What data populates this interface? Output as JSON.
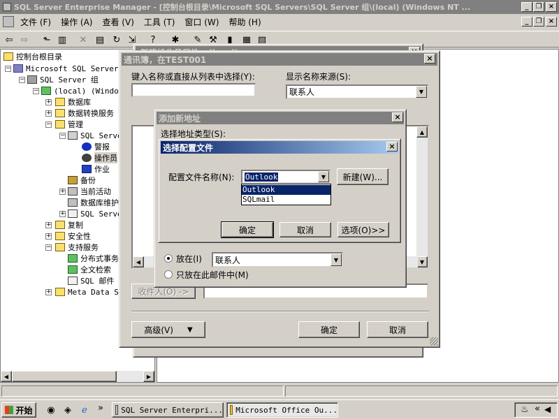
{
  "window": {
    "title": "SQL Server Enterprise Manager - [控制台根目录\\Microsoft SQL Servers\\SQL Server 组\\(local) (Windows NT ..."
  },
  "menu": [
    {
      "label": "文件 (F)"
    },
    {
      "label": "操作 (A)"
    },
    {
      "label": "查看 (V)"
    },
    {
      "label": "工具 (T)"
    },
    {
      "label": "窗口 (W)"
    },
    {
      "label": "帮助 (H)"
    }
  ],
  "tree": {
    "items": [
      {
        "label": "控制台根目录"
      },
      {
        "label": "Microsoft SQL Servers"
      },
      {
        "label": "SQL Server 组"
      },
      {
        "label": "(local) (Window"
      },
      {
        "label": "数据库"
      },
      {
        "label": "数据转换服务"
      },
      {
        "label": "管理"
      },
      {
        "label": "SQL Serve"
      },
      {
        "label": "警报"
      },
      {
        "label": "操作员"
      },
      {
        "label": "作业"
      },
      {
        "label": "备份"
      },
      {
        "label": "当前活动"
      },
      {
        "label": "数据库维护"
      },
      {
        "label": "SQL Serve"
      },
      {
        "label": "复制"
      },
      {
        "label": "安全性"
      },
      {
        "label": "支持服务"
      },
      {
        "label": "分布式事务"
      },
      {
        "label": "全文检索"
      },
      {
        "label": "SQL 邮件"
      },
      {
        "label": "Meta Data Se"
      }
    ]
  },
  "bg_dialog": {
    "title": "新建操作员属性 - (local)"
  },
  "address_book": {
    "title": "通讯簿，在TEST001",
    "name_label": "键入名称或直接从列表中选择(Y):",
    "name_value": "",
    "source_label": "显示名称来源(S):",
    "source_value": "联系人",
    "recipient_button": "收件人(O) ->",
    "advanced_button": "高级(V)",
    "ok_button": "确定",
    "cancel_button": "取消"
  },
  "new_address": {
    "title": "添加新地址",
    "type_label": "选择地址类型(S):",
    "put_in_label": "放在(I)",
    "put_in_value": "联系人",
    "only_this_label": "只放在此邮件中(M)"
  },
  "profile": {
    "title": "选择配置文件",
    "name_label": "配置文件名称(N):",
    "selected": "Outlook",
    "options": [
      "Outlook",
      "SQLmail"
    ],
    "new_button": "新建(W)...",
    "ok_button": "确定",
    "cancel_button": "取消",
    "options_button": "选项(O)>>"
  },
  "taskbar": {
    "start": "开始",
    "tasks": [
      {
        "label": "SQL Server Enterpri..."
      },
      {
        "label": "Microsoft Office Ou..."
      }
    ],
    "chevron": "»",
    "tray_chevron": "«"
  },
  "colors": {
    "active_title": "#0a246a",
    "inactive_title": "#808080",
    "face": "#d4d0c8",
    "selection": "#0a246a"
  }
}
